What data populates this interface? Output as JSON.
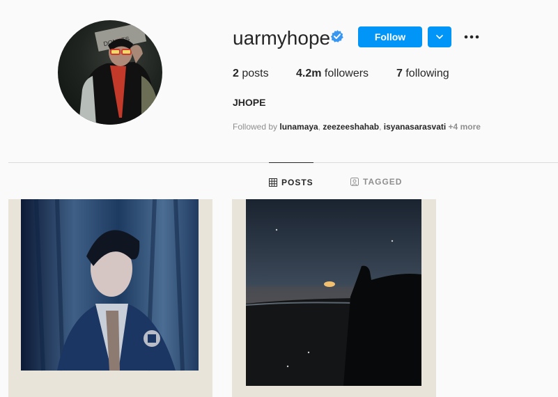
{
  "profile": {
    "username": "uarmyhope",
    "verified": true,
    "full_name": "JHOPE",
    "follow_label": "Follow",
    "posts_count": "2",
    "posts_label": "posts",
    "followers_count": "4.2m",
    "followers_label": "followers",
    "following_count": "7",
    "following_label": "following",
    "followed_by_prefix": "Followed by",
    "followed_by": [
      "lunamaya",
      "zeezeeshahab",
      "isyanasarasvati"
    ],
    "followed_by_more": "+4 more"
  },
  "tabs": [
    {
      "label": "POSTS",
      "icon": "grid-icon",
      "active": true
    },
    {
      "label": "TAGGED",
      "icon": "tagged-icon",
      "active": false
    }
  ],
  "colors": {
    "accent": "#0095f6",
    "text": "#262626",
    "muted": "#8e8e8e",
    "background": "#fafafa"
  }
}
